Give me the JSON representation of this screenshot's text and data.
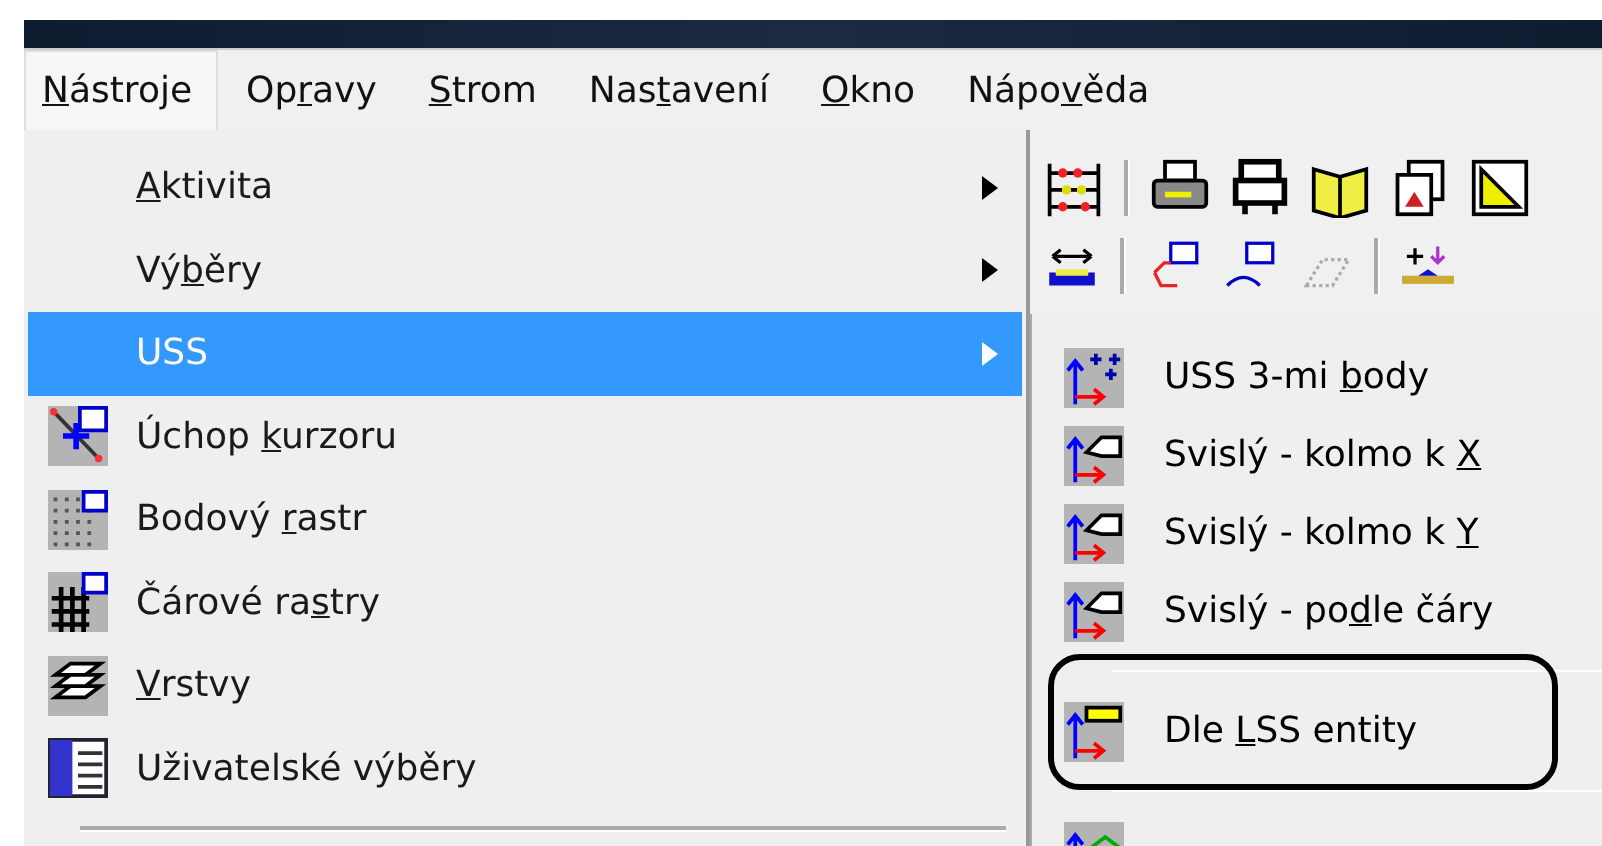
{
  "menubar": [
    {
      "key": "N",
      "after": "ástroje",
      "selected": true
    },
    {
      "before": "Op",
      "key": "r",
      "after": "avy",
      "selected": false
    },
    {
      "key": "S",
      "after": "trom",
      "selected": false
    },
    {
      "before": "Nas",
      "key": "t",
      "after": "avení",
      "selected": false
    },
    {
      "key": "O",
      "after": "kno",
      "selected": false
    },
    {
      "before": "Nápo",
      "key": "v",
      "after": "ěda",
      "selected": false
    }
  ],
  "menu": [
    {
      "kind": "submenu",
      "key": "A",
      "after": "ktivita",
      "selected": false
    },
    {
      "kind": "submenu",
      "before": "Vý",
      "key": "b",
      "after": "ěry",
      "selected": false
    },
    {
      "kind": "submenu",
      "before": "USS",
      "selected": true
    },
    {
      "kind": "command",
      "before": "Úchop ",
      "key": "k",
      "after": "urzoru",
      "selected": false
    },
    {
      "kind": "command",
      "before": "Bodový ",
      "key": "r",
      "after": "astr",
      "selected": false
    },
    {
      "kind": "command",
      "before": "Čárové ra",
      "key": "s",
      "after": "try",
      "selected": false
    },
    {
      "kind": "command",
      "key": "V",
      "after": "rstvy",
      "selected": false
    },
    {
      "kind": "command",
      "before": "Uživatelské výběry",
      "selected": false
    },
    {
      "kind": "separator"
    }
  ],
  "submenu": [
    {
      "kind": "command",
      "before": "USS 3-mi ",
      "key": "b",
      "after": "ody",
      "circled": false
    },
    {
      "kind": "command",
      "before": "Svislý - kolmo k ",
      "key": "X",
      "circled": false
    },
    {
      "kind": "command",
      "before": "Svislý - kolmo k ",
      "key": "Y",
      "circled": false
    },
    {
      "kind": "command",
      "before": "Svislý - po",
      "key": "d",
      "after": "le čáry",
      "circled": false
    },
    {
      "kind": "separator"
    },
    {
      "kind": "command",
      "before": "Dle ",
      "key": "L",
      "after": "SS entity",
      "circled": true
    },
    {
      "kind": "separator"
    }
  ]
}
